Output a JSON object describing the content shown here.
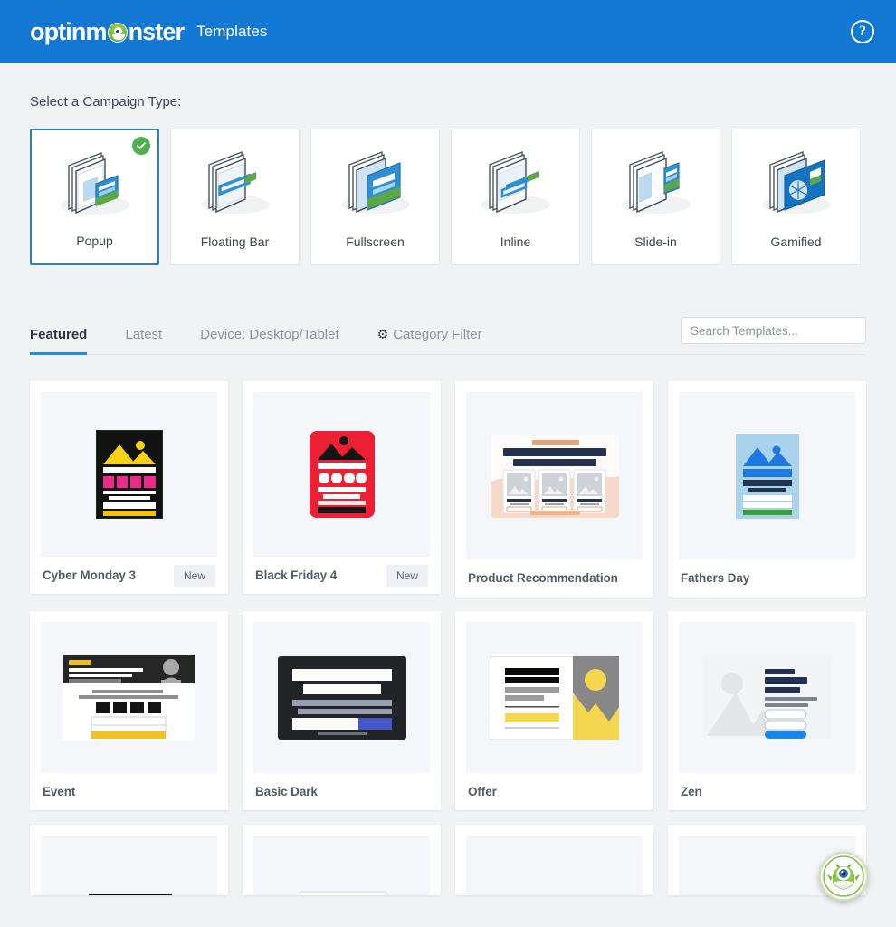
{
  "header": {
    "brand": "optinm",
    "brand_suffix": "nster",
    "subtitle": "Templates",
    "help_icon": "question-mark-circle-icon",
    "background": "#1278d4"
  },
  "campaign_section": {
    "label": "Select a Campaign Type:",
    "selected": "Popup",
    "types": [
      {
        "name": "Popup",
        "icon": "popup-campaign-icon",
        "selected": true
      },
      {
        "name": "Floating Bar",
        "icon": "floating-bar-campaign-icon",
        "selected": false
      },
      {
        "name": "Fullscreen",
        "icon": "fullscreen-campaign-icon",
        "selected": false
      },
      {
        "name": "Inline",
        "icon": "inline-campaign-icon",
        "selected": false
      },
      {
        "name": "Slide-in",
        "icon": "slide-in-campaign-icon",
        "selected": false
      },
      {
        "name": "Gamified",
        "icon": "gamified-campaign-icon",
        "selected": false
      }
    ]
  },
  "tabs": [
    {
      "label": "Featured",
      "active": true,
      "icon": null
    },
    {
      "label": "Latest",
      "active": false,
      "icon": null
    },
    {
      "label": "Device: Desktop/Tablet",
      "active": false,
      "icon": null
    },
    {
      "label": "Category Filter",
      "active": false,
      "icon": "gear-icon"
    }
  ],
  "search": {
    "placeholder": "Search Templates...",
    "value": ""
  },
  "templates": {
    "row1": [
      {
        "name": "Cyber Monday 3",
        "badge": "New",
        "preview": "cyber-monday-3-preview"
      },
      {
        "name": "Black Friday 4",
        "badge": "New",
        "preview": "black-friday-4-preview"
      },
      {
        "name": "Product Recommendation",
        "badge": null,
        "preview": "product-recommendation-preview"
      },
      {
        "name": "Fathers Day",
        "badge": null,
        "preview": "fathers-day-preview"
      }
    ],
    "row2": [
      {
        "name": "Event",
        "badge": null,
        "preview": "event-preview"
      },
      {
        "name": "Basic Dark",
        "badge": null,
        "preview": "basic-dark-preview"
      },
      {
        "name": "Offer",
        "badge": null,
        "preview": "offer-preview"
      },
      {
        "name": "Zen",
        "badge": null,
        "preview": "zen-preview"
      }
    ],
    "row3": [
      {
        "name": "",
        "badge": null,
        "preview": "partial-dark-preview"
      },
      {
        "name": "",
        "badge": null,
        "preview": "partial-light-preview"
      },
      {
        "name": "",
        "badge": null,
        "preview": "partial-orange-preview"
      },
      {
        "name": "",
        "badge": null,
        "preview": "partial-red-preview"
      }
    ]
  },
  "chat_widget": {
    "icon": "optinmonster-chat-monster-icon"
  },
  "colors": {
    "header_blue": "#1278d4",
    "accent_blue": "#1f8ce0",
    "selected_border": "#2b7fc4",
    "check_green": "#4caf50",
    "page_bg": "#f1f2f4",
    "badge_bg": "#eef0f4"
  }
}
